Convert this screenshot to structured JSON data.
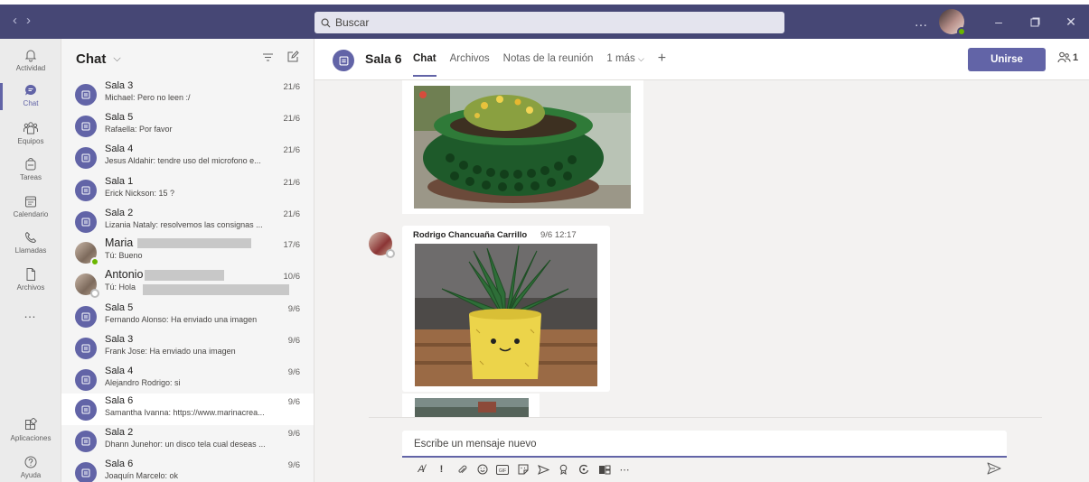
{
  "titlebar": {
    "search_placeholder": "Buscar",
    "more": "…",
    "window_controls": [
      "minimize",
      "maximize",
      "close"
    ],
    "brand_color": "#464775"
  },
  "rail": {
    "items": [
      {
        "label": "Actividad",
        "icon": "bell-icon"
      },
      {
        "label": "Chat",
        "icon": "chat-icon",
        "active": true
      },
      {
        "label": "Equipos",
        "icon": "teams-icon"
      },
      {
        "label": "Tareas",
        "icon": "tasks-icon"
      },
      {
        "label": "Calendario",
        "icon": "calendar-icon"
      },
      {
        "label": "Llamadas",
        "icon": "phone-icon"
      },
      {
        "label": "Archivos",
        "icon": "file-icon"
      }
    ],
    "more": "…",
    "bottom": [
      {
        "label": "Aplicaciones",
        "icon": "apps-icon"
      },
      {
        "label": "Ayuda",
        "icon": "help-icon"
      }
    ]
  },
  "chatlist": {
    "title": "Chat",
    "conversations": [
      {
        "name": "Sala 3",
        "preview": "Michael: Pero no leen :/",
        "date": "21/6"
      },
      {
        "name": "Sala 5",
        "preview": "Rafaella: Por favor",
        "date": "21/6"
      },
      {
        "name": "Sala 4",
        "preview": "Jesus Aldahir: tendre uso del microfono e...",
        "date": "21/6"
      },
      {
        "name": "Sala 1",
        "preview": "Erick Nickson: 15 ?",
        "date": "21/6"
      },
      {
        "name": "Sala 2",
        "preview": "Lizania Nataly: resolvemos las consignas ...",
        "date": "21/6"
      },
      {
        "name": "Maria",
        "preview": "Tú: Bueno",
        "date": "17/6"
      },
      {
        "name": "Antonio",
        "preview": "Tú: Hola",
        "date": "10/6"
      },
      {
        "name": "Sala 5",
        "preview": "Fernando Alonso: Ha enviado una imagen",
        "date": "9/6"
      },
      {
        "name": "Sala 3",
        "preview": "Frank Jose: Ha enviado una imagen",
        "date": "9/6"
      },
      {
        "name": "Sala 4",
        "preview": "Alejandro Rodrigo: si",
        "date": "9/6"
      },
      {
        "name": "Sala 6",
        "preview": "Samantha Ivanna: https://www.marinacrea...",
        "date": "9/6"
      },
      {
        "name": "Sala 2",
        "preview": "Dhann Junehor: un disco tela cual deseas ...",
        "date": "9/6"
      },
      {
        "name": "Sala 6",
        "preview": "Joaquín Marcelo: ok",
        "date": "9/6"
      }
    ]
  },
  "main": {
    "title": "Sala 6",
    "tabs": [
      "Chat",
      "Archivos",
      "Notas de la reunión",
      "1 más"
    ],
    "join_label": "Unirse",
    "participants": "1",
    "message": {
      "author": "Rodrigo Chancuaña Carrillo",
      "time": "9/6 12:17"
    },
    "compose_placeholder": "Escribe un mensaje nuevo",
    "accent_color": "#6264a7"
  }
}
